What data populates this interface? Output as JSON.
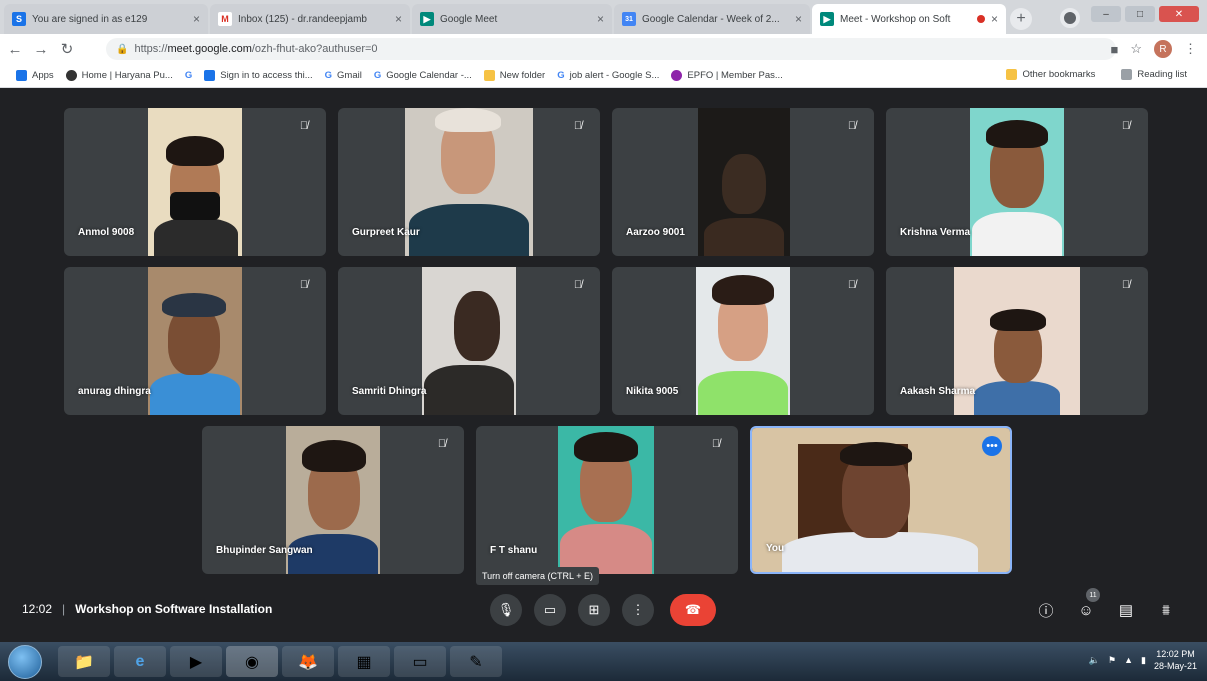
{
  "browser": {
    "tabs": [
      {
        "title": "You are signed in as e129",
        "favicon": "S",
        "color": "#1a73e8"
      },
      {
        "title": "Inbox (125) - dr.randeepjamb",
        "favicon": "M",
        "color": "#d93025"
      },
      {
        "title": "Google Meet",
        "favicon": "▶",
        "color": "#00897b"
      },
      {
        "title": "Google Calendar - Week of 2...",
        "favicon": "31",
        "color": "#4285f4"
      },
      {
        "title": "Meet - Workshop on Soft",
        "favicon": "▶",
        "color": "#00897b"
      }
    ],
    "url_prefix": "https://",
    "url_host": "meet.google.com",
    "url_path": "/ozh-fhut-ako?authuser=0",
    "profile_initial": "R",
    "bookmarks": [
      "Apps",
      "Home | Haryana Pu...",
      "G",
      "Sign in to access thi...",
      "Gmail",
      "Google Calendar -...",
      "New folder",
      "job alert - Google S...",
      "EPFO | Member Pas..."
    ],
    "bookmarks_right": [
      "Other bookmarks",
      "Reading list"
    ]
  },
  "participants": [
    {
      "name": "Anmol 9008"
    },
    {
      "name": "Gurpreet Kaur"
    },
    {
      "name": "Aarzoo 9001"
    },
    {
      "name": "Krishna Verma"
    },
    {
      "name": "anurag dhingra"
    },
    {
      "name": "Samriti Dhingra"
    },
    {
      "name": "Nikita 9005"
    },
    {
      "name": "Aakash Sharma"
    },
    {
      "name": "Bhupinder Sangwan"
    },
    {
      "name": "F T shanu"
    },
    {
      "name": "You"
    }
  ],
  "tooltip": "Turn off camera (CTRL + E)",
  "meeting": {
    "time": "12:02",
    "separator": "|",
    "title": "Workshop on Software Installation",
    "participant_count": "11"
  },
  "taskbar": {
    "time": "12:02 PM",
    "date": "28-May-21"
  }
}
